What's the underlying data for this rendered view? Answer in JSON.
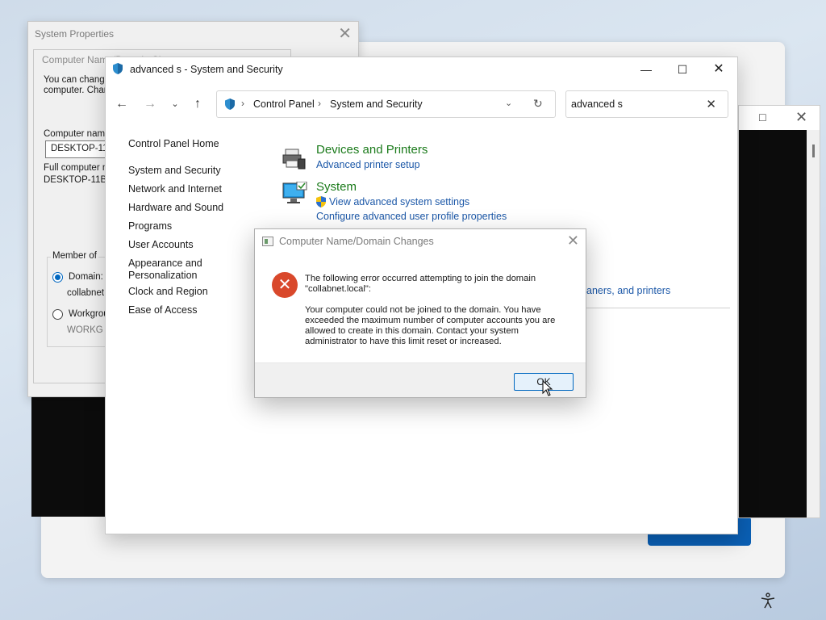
{
  "background": {
    "accent_button_color": "#0a5fb4"
  },
  "console": {
    "maximize_icon": "maximize-icon",
    "close_icon": "close-icon"
  },
  "system_properties": {
    "title": "System Properties",
    "inner_title": "Computer Name/Domain Changes",
    "intro_line1": "You can change",
    "intro_line2": "computer. Chang",
    "computer_name_label": "Computer name:",
    "computer_name_value": "DESKTOP-11B4",
    "full_name_label": "Full computer na",
    "full_name_value": "DESKTOP-11B4",
    "member_of_label": "Member of",
    "domain_label": "Domain:",
    "domain_value": "collabnet",
    "workgroup_label": "Workgrou",
    "workgroup_value": "WORKG"
  },
  "control_panel": {
    "window_title": "advanced s - System and Security",
    "breadcrumb": [
      "Control Panel",
      "System and Security"
    ],
    "search_value": "advanced s",
    "nav": [
      "Control Panel Home",
      "System and Security",
      "Network and Internet",
      "Hardware and Sound",
      "Programs",
      "User Accounts",
      "Appearance and",
      "Personalization",
      "Clock and Region",
      "Ease of Access"
    ],
    "results": {
      "devices_title": "Devices and Printers",
      "devices_link": "Advanced printer setup",
      "system_title": "System",
      "system_link1": "View advanced system settings",
      "system_link2": "Configure advanced user profile properties",
      "partial_link": "aners, and printers"
    }
  },
  "error_dialog": {
    "title": "Computer Name/Domain Changes",
    "line1": "The following error occurred attempting to join the domain",
    "line2": "\"collabnet.local\":",
    "body": [
      "Your computer could not be joined to the domain. You have",
      "exceeded the maximum number of computer accounts you are",
      "allowed to create in this domain. Contact your system",
      "administrator to have this limit reset or increased."
    ],
    "ok_label": "OK",
    "error_color": "#d9482b"
  }
}
